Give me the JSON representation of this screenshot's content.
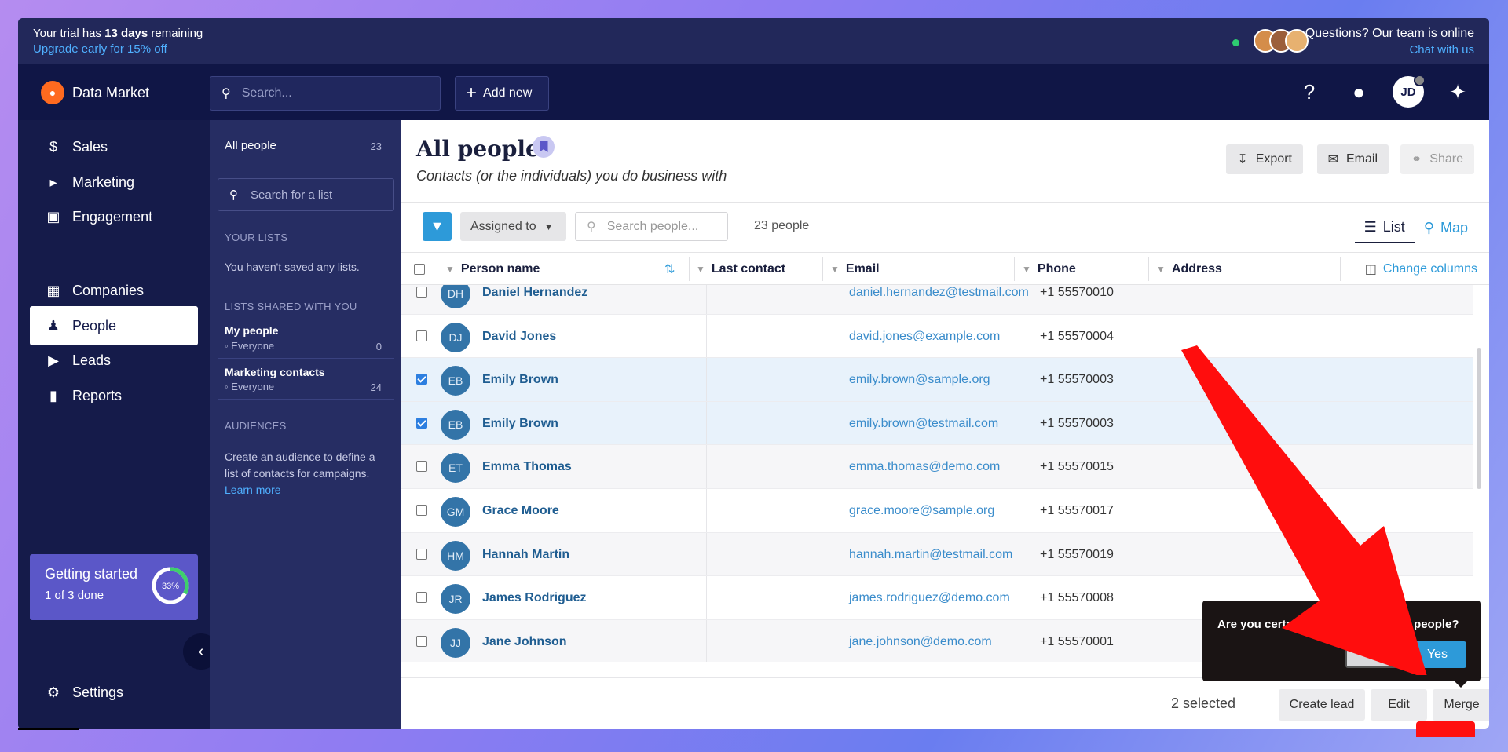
{
  "trial": {
    "prefix": "Your trial has ",
    "days": "13 days",
    "suffix": " remaining",
    "upgrade": "Upgrade early for 15% off"
  },
  "support": {
    "question": "Questions? Our team is online",
    "chat": "Chat with us"
  },
  "brand": {
    "name": "Data Market"
  },
  "global_search": {
    "placeholder": "Search..."
  },
  "add_new_label": "Add new",
  "user_initials": "JD",
  "nav": {
    "sales": "Sales",
    "marketing": "Marketing",
    "engagement": "Engagement",
    "companies": "Companies",
    "people": "People",
    "leads": "Leads",
    "reports": "Reports",
    "settings": "Settings"
  },
  "getting_started": {
    "title": "Getting started",
    "subtitle": "1 of 3 done",
    "progress_label": "33%",
    "progress": 0.33
  },
  "lists_panel": {
    "all_people": "All people",
    "all_people_count": "23",
    "search_placeholder": "Search for a list",
    "your_lists_header": "YOUR LISTS",
    "no_lists_text": "You haven't saved any lists.",
    "shared_header": "LISTS SHARED WITH YOU",
    "shared": [
      {
        "name": "My people",
        "scope": "Everyone",
        "count": "0"
      },
      {
        "name": "Marketing contacts",
        "scope": "Everyone",
        "count": "24"
      }
    ],
    "audiences_header": "AUDIENCES",
    "audiences_text": "Create an audience to define a list of contacts for campaigns.",
    "learn_more": "Learn more"
  },
  "page": {
    "title": "All people",
    "subtitle": "Contacts (or the individuals) you do business with",
    "export": "Export",
    "email": "Email",
    "share": "Share"
  },
  "toolbar": {
    "assigned_to": "Assigned to",
    "search_placeholder": "Search people...",
    "count": "23 people",
    "list_tab": "List",
    "map_tab": "Map"
  },
  "table": {
    "columns": {
      "name": "Person name",
      "last_contact": "Last contact",
      "email": "Email",
      "phone": "Phone",
      "address": "Address"
    },
    "change_columns": "Change columns",
    "rows": [
      {
        "initials": "DH",
        "name": "Daniel Hernandez",
        "email": "daniel.hernandez@testmail.com",
        "phone": "+1 55570010",
        "checked": false
      },
      {
        "initials": "DJ",
        "name": "David Jones",
        "email": "david.jones@example.com",
        "phone": "+1 55570004",
        "checked": false
      },
      {
        "initials": "EB",
        "name": "Emily Brown",
        "email": "emily.brown@sample.org",
        "phone": "+1 55570003",
        "checked": true
      },
      {
        "initials": "EB",
        "name": "Emily Brown",
        "email": "emily.brown@testmail.com",
        "phone": "+1 55570003",
        "checked": true
      },
      {
        "initials": "ET",
        "name": "Emma Thomas",
        "email": "emma.thomas@demo.com",
        "phone": "+1 55570015",
        "checked": false
      },
      {
        "initials": "GM",
        "name": "Grace Moore",
        "email": "grace.moore@sample.org",
        "phone": "+1 55570017",
        "checked": false
      },
      {
        "initials": "HM",
        "name": "Hannah Martin",
        "email": "hannah.martin@testmail.com",
        "phone": "+1 55570019",
        "checked": false
      },
      {
        "initials": "JR",
        "name": "James Rodriguez",
        "email": "james.rodriguez@demo.com",
        "phone": "+1 55570008",
        "checked": false
      },
      {
        "initials": "JJ",
        "name": "Jane Johnson",
        "email": "jane.johnson@demo.com",
        "phone": "+1 55570001",
        "checked": false
      }
    ]
  },
  "footer": {
    "selected": "2 selected",
    "create_lead": "Create lead",
    "edit": "Edit",
    "merge": "Merge"
  },
  "confirm": {
    "question": "Are you certain you want to merge people?",
    "no": "No",
    "yes": "Yes"
  },
  "colors": {
    "accent": "#2d9ad9",
    "sidebar": "#151b4a",
    "highlight_arrow": "#ff1010"
  }
}
